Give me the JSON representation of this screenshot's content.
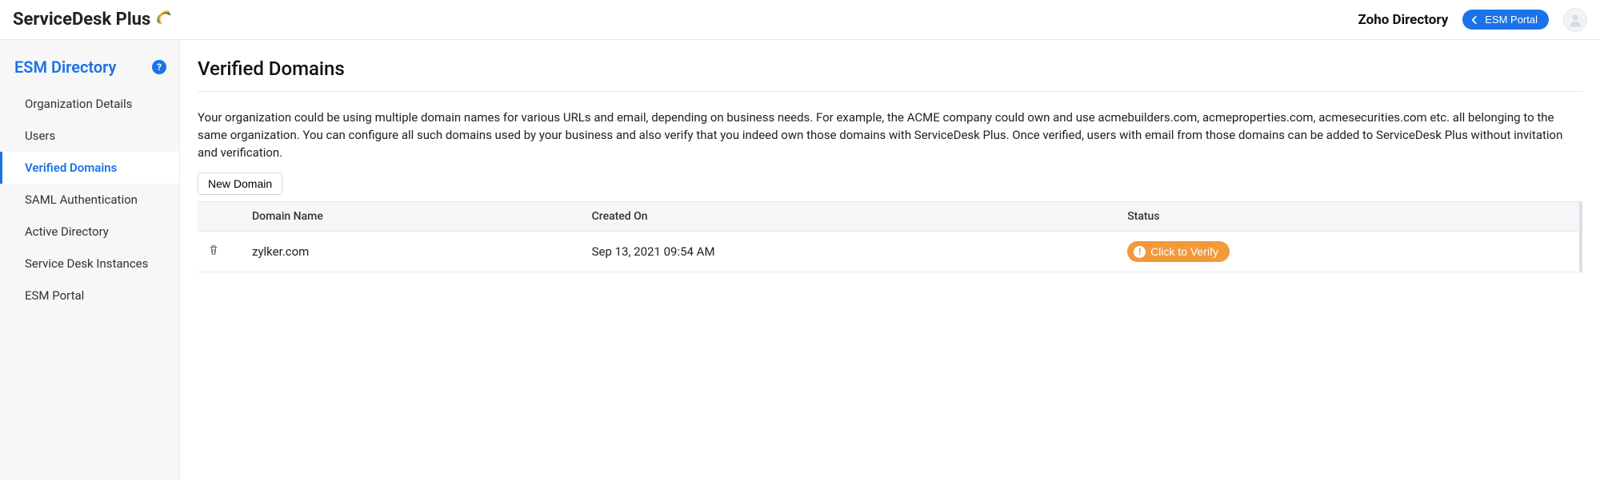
{
  "header": {
    "product_name": "ServiceDesk Plus",
    "zoho_label": "Zoho Directory",
    "esm_portal_label": "ESM Portal"
  },
  "sidebar": {
    "title": "ESM Directory",
    "help_label": "?",
    "items": [
      {
        "label": "Organization Details",
        "active": false
      },
      {
        "label": "Users",
        "active": false
      },
      {
        "label": "Verified Domains",
        "active": true
      },
      {
        "label": "SAML Authentication",
        "active": false
      },
      {
        "label": "Active Directory",
        "active": false
      },
      {
        "label": "Service Desk Instances",
        "active": false
      },
      {
        "label": "ESM Portal",
        "active": false
      }
    ]
  },
  "page": {
    "title": "Verified Domains",
    "description": "Your organization could be using multiple domain names for various URLs and email, depending on business needs. For example, the ACME company could own and use acmebuilders.com, acmeproperties.com, acmesecurities.com etc. all belonging to the same organization. You can configure all such domains used by your business and also verify that you indeed own those domains with ServiceDesk Plus. Once verified, users with email from those domains can be added to ServiceDesk Plus without invitation and verification.",
    "new_domain_label": "New Domain"
  },
  "table": {
    "columns": {
      "domain": "Domain Name",
      "created": "Created On",
      "status": "Status"
    },
    "rows": [
      {
        "domain": "zylker.com",
        "created": "Sep 13, 2021 09:54 AM",
        "status_label": "Click to Verify"
      }
    ]
  }
}
